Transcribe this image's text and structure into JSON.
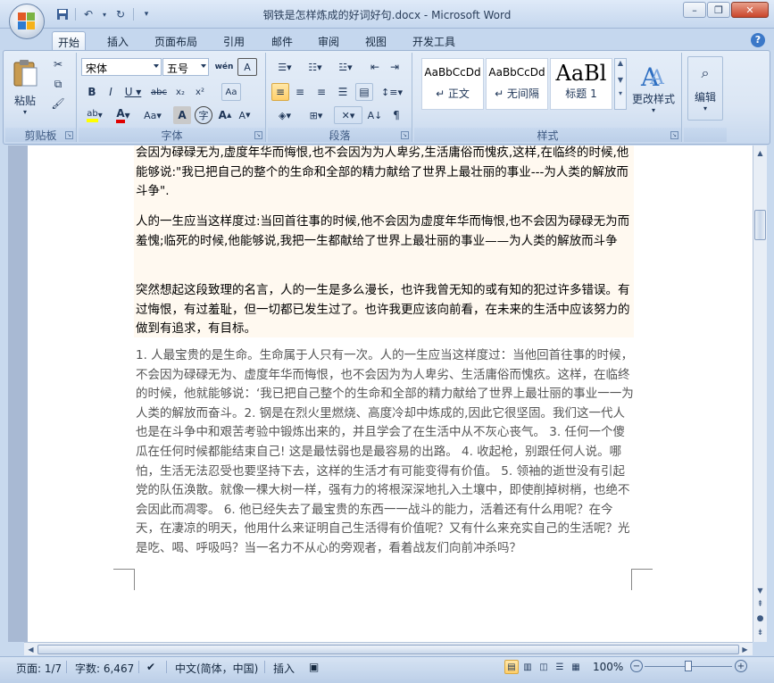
{
  "window": {
    "title": "钢铁是怎样炼成的好词好句.docx - Microsoft Word",
    "minimize_icon": "minimize-icon",
    "maximize_icon": "restore-icon",
    "close_icon": "close-icon"
  },
  "tabs": [
    "开始",
    "插入",
    "页面布局",
    "引用",
    "邮件",
    "审阅",
    "视图",
    "开发工具"
  ],
  "ribbon": {
    "clipboard": {
      "paste_label": "粘贴",
      "group_label": "剪贴板"
    },
    "font": {
      "font_name": "宋体",
      "font_size": "五号",
      "group_label": "字体"
    },
    "paragraph": {
      "group_label": "段落"
    },
    "styles": {
      "group_label": "样式",
      "items": [
        {
          "sample": "AaBbCcDd",
          "name": "↵ 正文"
        },
        {
          "sample": "AaBbCcDd",
          "name": "↵ 无间隔"
        },
        {
          "sample": "AaBl",
          "name": "标题 1"
        }
      ],
      "change_styles_label": "更改样式"
    },
    "editing": {
      "label": "编辑"
    }
  },
  "document": {
    "paragraphs": [
      "会因为碌碌无为,虚度年华而悔恨,也不会因为为人卑劣,生活庸俗而愧疚,这样,在临终的时候,他能够说:\"我已把自己的整个的生命和全部的精力献给了世界上最壮丽的事业---为人类的解放而斗争\".",
      "人的一生应当这样度过:当回首往事的时候,他不会因为虚度年华而悔恨,也不会因为碌碌无为而羞愧;临死的时候,他能够说,我把一生都献给了世界上最壮丽的事业——为人类的解放而斗争",
      "突然想起这段致理的名言，人的一生是多么漫长，也许我曾无知的或有知的犯过许多错误。有过悔恨，有过羞耻，但一切都已发生过了。也许我更应该向前看，在未来的生活中应该努力的做到有追求，有目标。",
      "1. 人最宝贵的是生命。生命属于人只有一次。人的一生应当这样度过：当他回首往事的时候，不会因为碌碌无为、虚度年华而悔恨，也不会因为为人卑劣、生活庸俗而愧疚。这样，在临终的时候，他就能够说：‘我已把自己整个的生命和全部的精力献给了世界上最壮丽的事业一一为人类的解放而奋斗。2. 钢是在烈火里燃烧、高度冷却中炼成的,因此它很坚固。我们这一代人也是在斗争中和艰苦考验中锻炼出来的，并且学会了在生活中从不灰心丧气。 3. 任何一个傻瓜在任何时候都能结束自己! 这是最怯弱也是最容易的出路。 4. 收起枪，别跟任何人说。哪怕，生活无法忍受也要坚持下去，这样的生活才有可能变得有价值。 5. 领袖的逝世没有引起党的队伍涣散。就像一棵大树一样，强有力的将根深深地扎入土壤中，即使削掉树梢，也绝不会因此而凋零。 6. 他已经失去了最宝贵的东西一一战斗的能力，活着还有什么用呢？在今天，在凄凉的明天，他用什么来证明自己生活得有价值呢？又有什么来充实自己的生活呢？光是吃、喝、呼吸吗？当一名力不从心的旁观者，看着战友们向前冲杀吗？"
    ]
  },
  "status": {
    "page": "页面: 1/7",
    "words": "字数: 6,467",
    "language": "中文(简体，中国)",
    "mode": "插入",
    "zoom": "100%"
  }
}
